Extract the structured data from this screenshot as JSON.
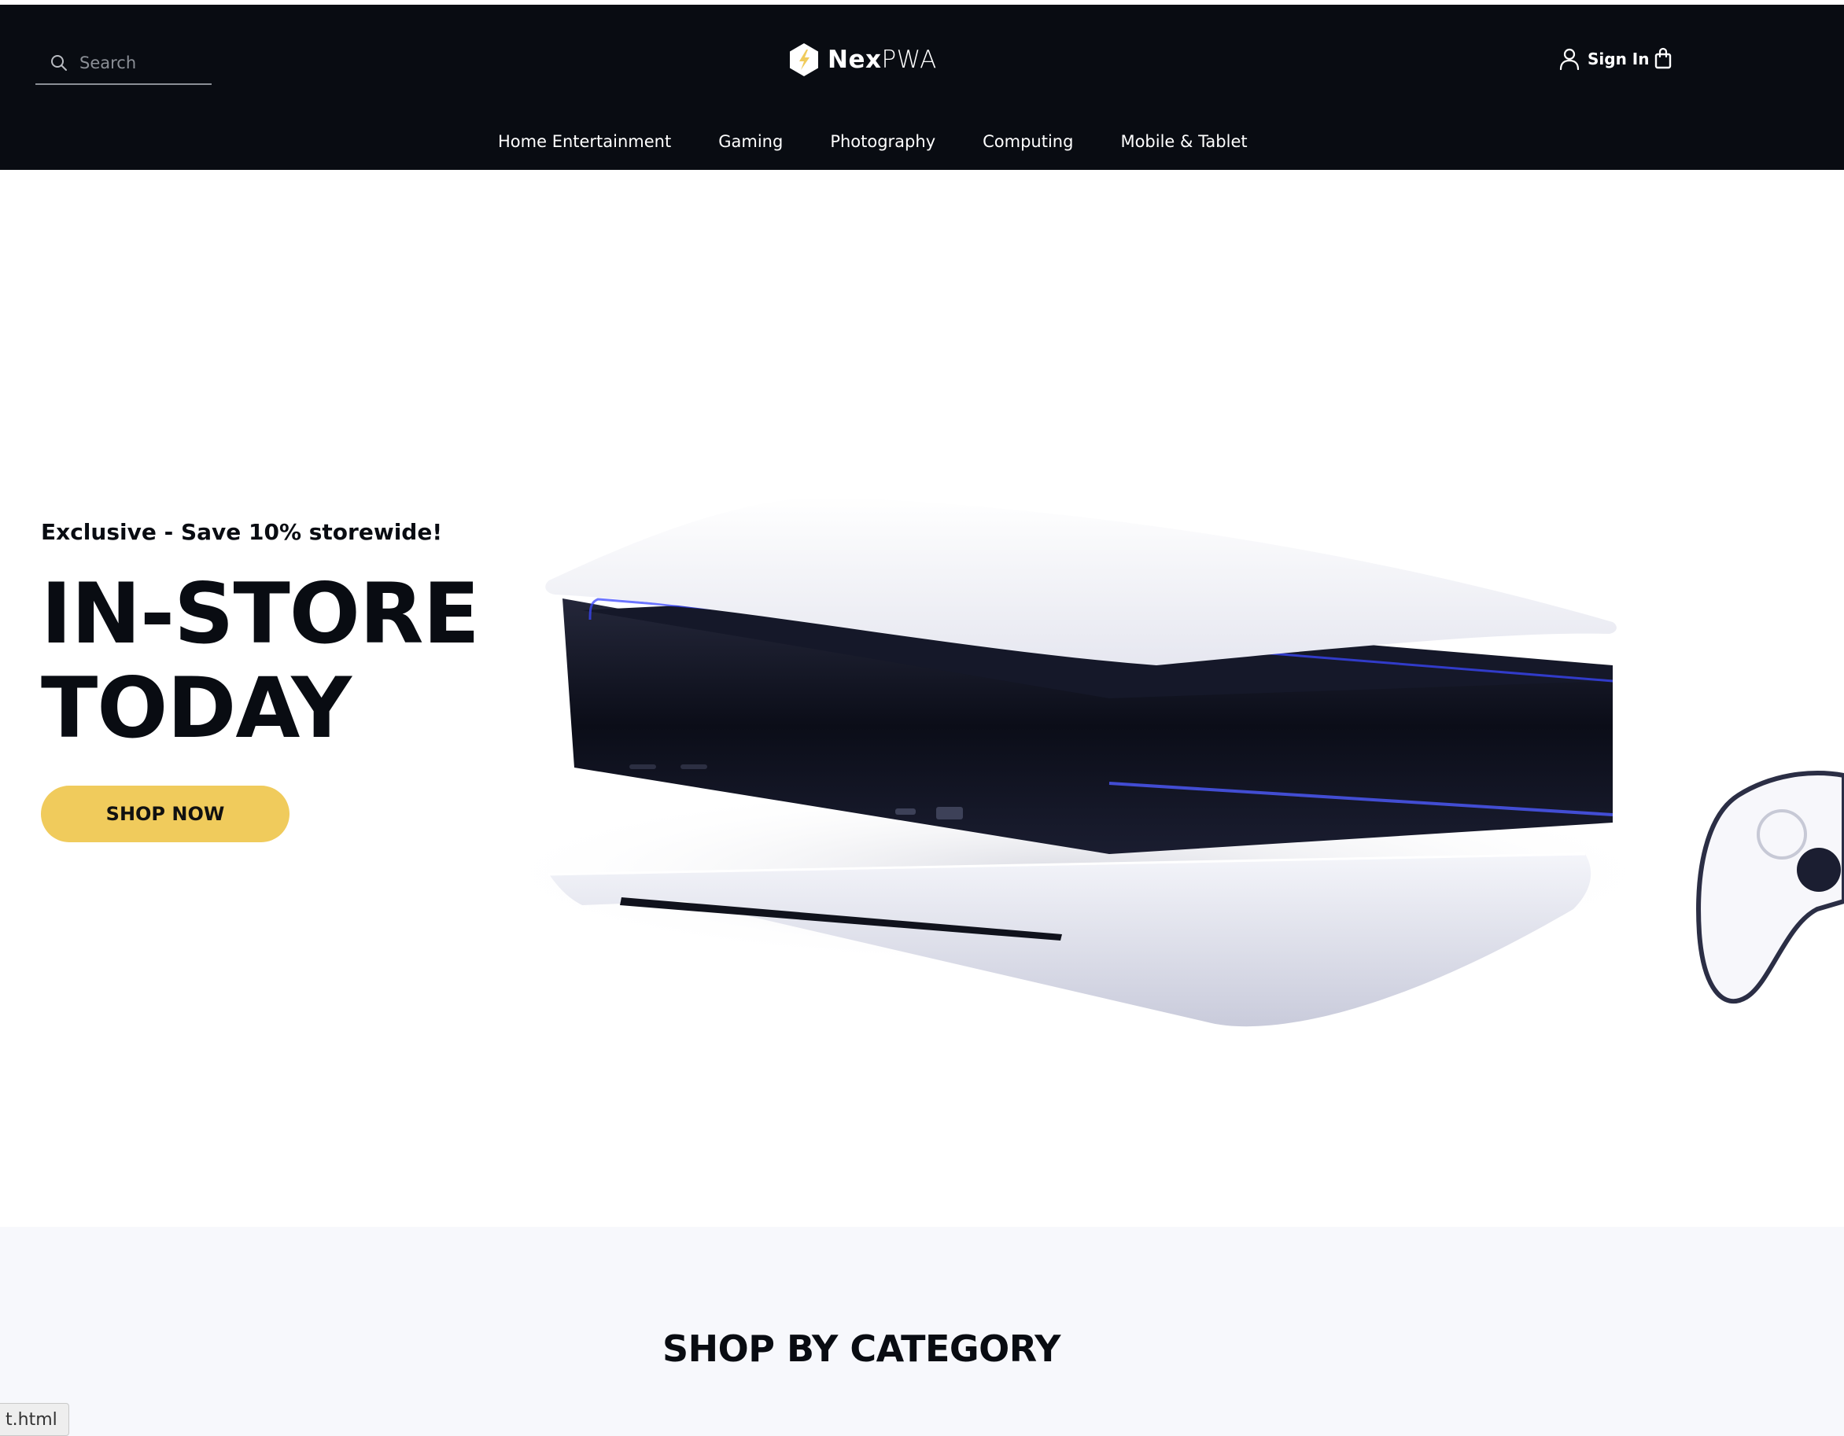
{
  "header": {
    "search": {
      "placeholder": "Search",
      "icon": "search-icon"
    },
    "logo": {
      "bold": "Nex",
      "light": "PWA",
      "icon": "hexagon-bolt-icon",
      "accent": "#f0cb5c"
    },
    "account": {
      "sign_in_label": "Sign In",
      "user_icon": "user-icon",
      "cart_icon": "shopping-bag-icon"
    },
    "nav": [
      {
        "label": "Home Entertainment"
      },
      {
        "label": "Gaming"
      },
      {
        "label": "Photography"
      },
      {
        "label": "Computing"
      },
      {
        "label": "Mobile & Tablet"
      }
    ],
    "background": "#090c12"
  },
  "hero": {
    "eyebrow": "Exclusive - Save 10% storewide!",
    "headline_line1": "IN-STORE",
    "headline_line2": "TODAY",
    "cta_label": "SHOP NOW",
    "cta_color": "#f0cb5c"
  },
  "category": {
    "title": "SHOP BY CATEGORY"
  },
  "status_bar": {
    "text": "t.html"
  }
}
